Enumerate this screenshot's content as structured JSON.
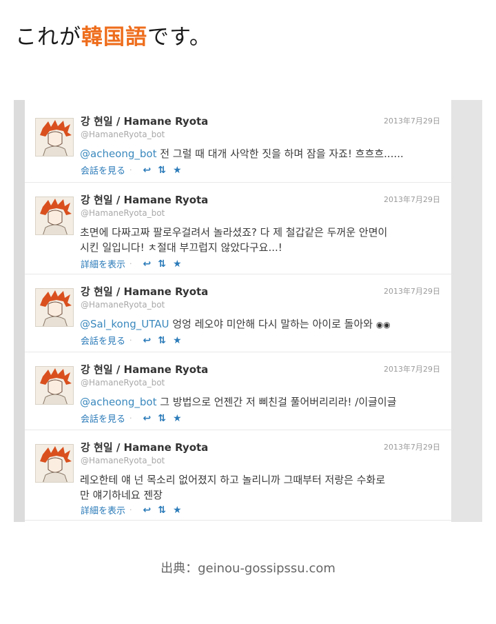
{
  "headline": {
    "prefix": "これが",
    "accent": "韓国語",
    "suffix": "です。"
  },
  "accent_color": "#ee6d1c",
  "tweets": [
    {
      "name": "강 현일 / Hamane Ryota",
      "handle": "@HamaneRyota_bot",
      "date": "2013年7月29日",
      "mention": "@acheong_bot",
      "text": " 전 그럴 때 대개 사악한 짓을 하며 잠을 자죠! 흐흐흐......",
      "line2": "",
      "action_label": "会話を見る",
      "icons": [
        "reply-icon",
        "retweet-icon",
        "favorite-icon"
      ]
    },
    {
      "name": "강 현일 / Hamane Ryota",
      "handle": "@HamaneRyota_bot",
      "date": "2013年7月29日",
      "mention": "",
      "text": "초면에 다짜고짜 팔로우걸려서 놀라셨죠? 다 제 철갑같은 두꺼운 안면이",
      "line2": "시킨 일입니다! ㅊ절대 부끄럽지 않았다구요...!",
      "action_label": "詳細を表示",
      "icons": [
        "reply-icon",
        "retweet-icon",
        "favorite-icon"
      ]
    },
    {
      "name": "강 현일 / Hamane Ryota",
      "handle": "@HamaneRyota_bot",
      "date": "2013年7月29日",
      "mention": "@Sal_kong_UTAU",
      "text": " 엉엉 레오야 미안해 다시 말하는 아이로 돌아와 ",
      "line2": "",
      "action_label": "会話を見る",
      "icons": [
        "reply-icon",
        "retweet-icon",
        "favorite-icon"
      ]
    },
    {
      "name": "강 현일 / Hamane Ryota",
      "handle": "@HamaneRyota_bot",
      "date": "2013年7月29日",
      "mention": "@acheong_bot",
      "text": " 그 방법으로 언젠간 저 삐친걸 풀어버리리라! /이글이글",
      "line2": "",
      "action_label": "会話を見る",
      "icons": [
        "reply-icon",
        "retweet-icon",
        "favorite-icon"
      ]
    },
    {
      "name": "강 현일 / Hamane Ryota",
      "handle": "@HamaneRyota_bot",
      "date": "2013年7月29日",
      "mention": "",
      "text": "레오한테 얘 넌 목소리 없어졌지 하고 놀리니까 그때부터 저랑은 수화로",
      "line2": "만 얘기하네요 젠장",
      "action_label": "詳細を表示",
      "icons": [
        "reply-icon",
        "retweet-icon",
        "favorite-icon"
      ]
    }
  ],
  "source": "出典：geinou-gossipssu.com"
}
